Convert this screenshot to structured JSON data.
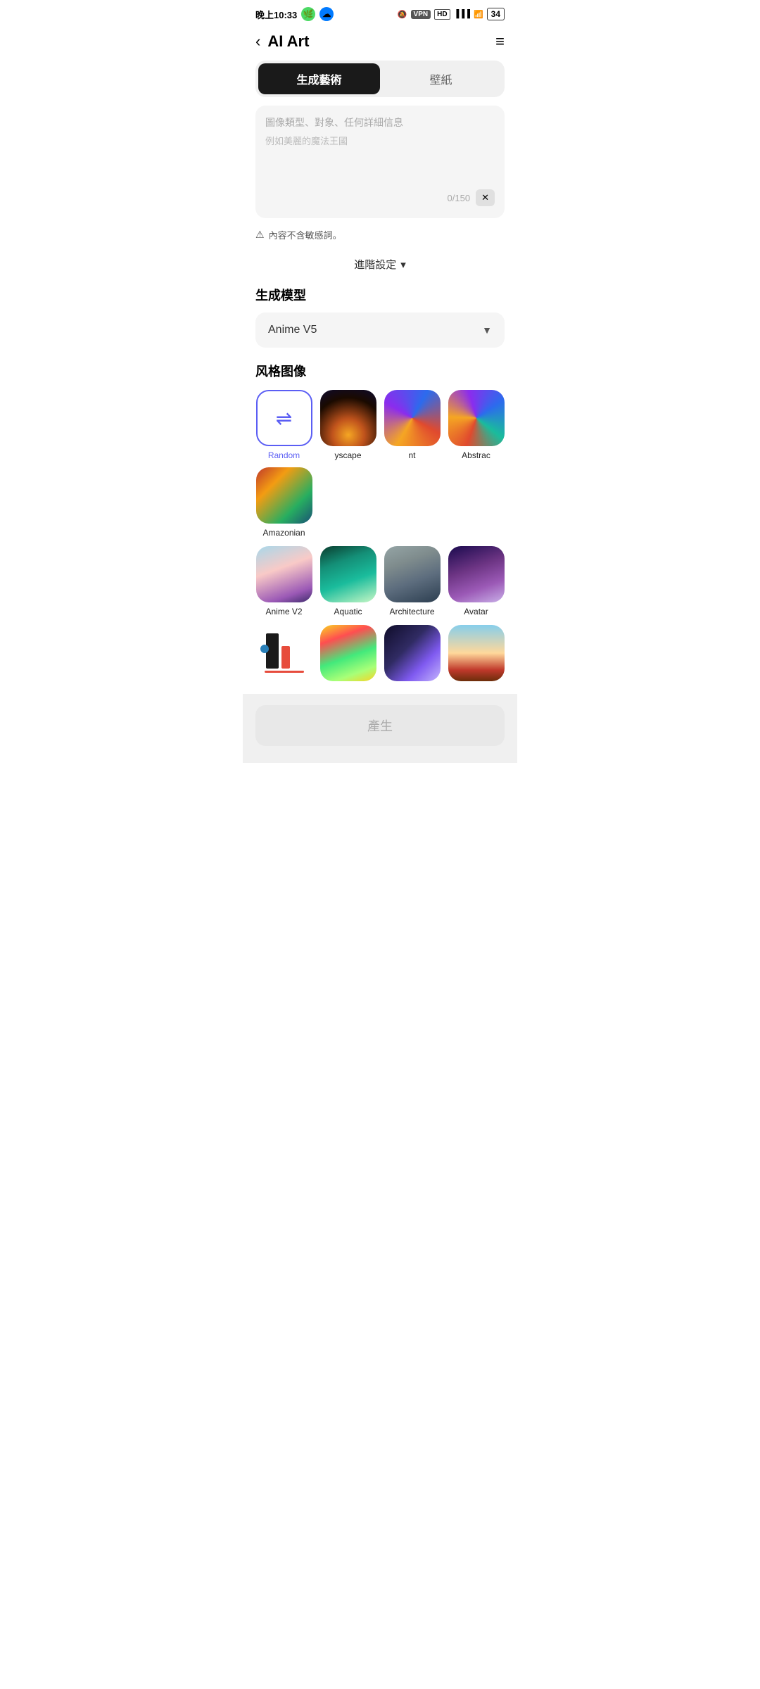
{
  "statusBar": {
    "time": "晚上10:33",
    "icons": [
      "🟢",
      "🔵"
    ],
    "rightIcons": "🔕 VPN HD ▾ 📶 34"
  },
  "header": {
    "back": "‹",
    "title": "AI Art",
    "menu": "≡"
  },
  "tabs": [
    {
      "id": "generate",
      "label": "生成藝術",
      "active": true
    },
    {
      "id": "wallpaper",
      "label": "壁紙",
      "active": false
    }
  ],
  "inputArea": {
    "hint": "圖像類型、對象、任何詳細信息",
    "example": "例如美麗的魔法王國",
    "charCount": "0/150",
    "clearLabel": "✕"
  },
  "warning": {
    "icon": "⚠",
    "text": "內容不含敏感詞。"
  },
  "advancedSettings": {
    "label": "進階設定",
    "arrow": "▾"
  },
  "modelSection": {
    "title": "生成模型",
    "selected": "Anime V5",
    "arrow": "▼"
  },
  "styleSection": {
    "title": "风格图像",
    "items": [
      {
        "id": "random",
        "label": "Random",
        "type": "random",
        "labelColor": "blue"
      },
      {
        "id": "cityscape",
        "label": "yscape",
        "type": "cityscape"
      },
      {
        "id": "abstract1",
        "label": "nt",
        "type": "abstract1"
      },
      {
        "id": "abstract",
        "label": "Abstrac",
        "type": "abstract"
      },
      {
        "id": "amazonian",
        "label": "Amazonian",
        "type": "amazonian"
      },
      {
        "id": "anime",
        "label": "Anime V2",
        "type": "anime"
      },
      {
        "id": "aquatic",
        "label": "Aquatic",
        "type": "aquatic"
      },
      {
        "id": "architecture",
        "label": "Architecture",
        "type": "architecture"
      },
      {
        "id": "avatar",
        "label": "Avatar",
        "type": "avatar"
      },
      {
        "id": "abstract2",
        "label": "",
        "type": "abstract2"
      },
      {
        "id": "candy",
        "label": "",
        "type": "candy"
      },
      {
        "id": "cosmic",
        "label": "",
        "type": "cosmic"
      },
      {
        "id": "landscape",
        "label": "",
        "type": "landscape"
      }
    ]
  },
  "generateButton": {
    "label": "產生"
  }
}
